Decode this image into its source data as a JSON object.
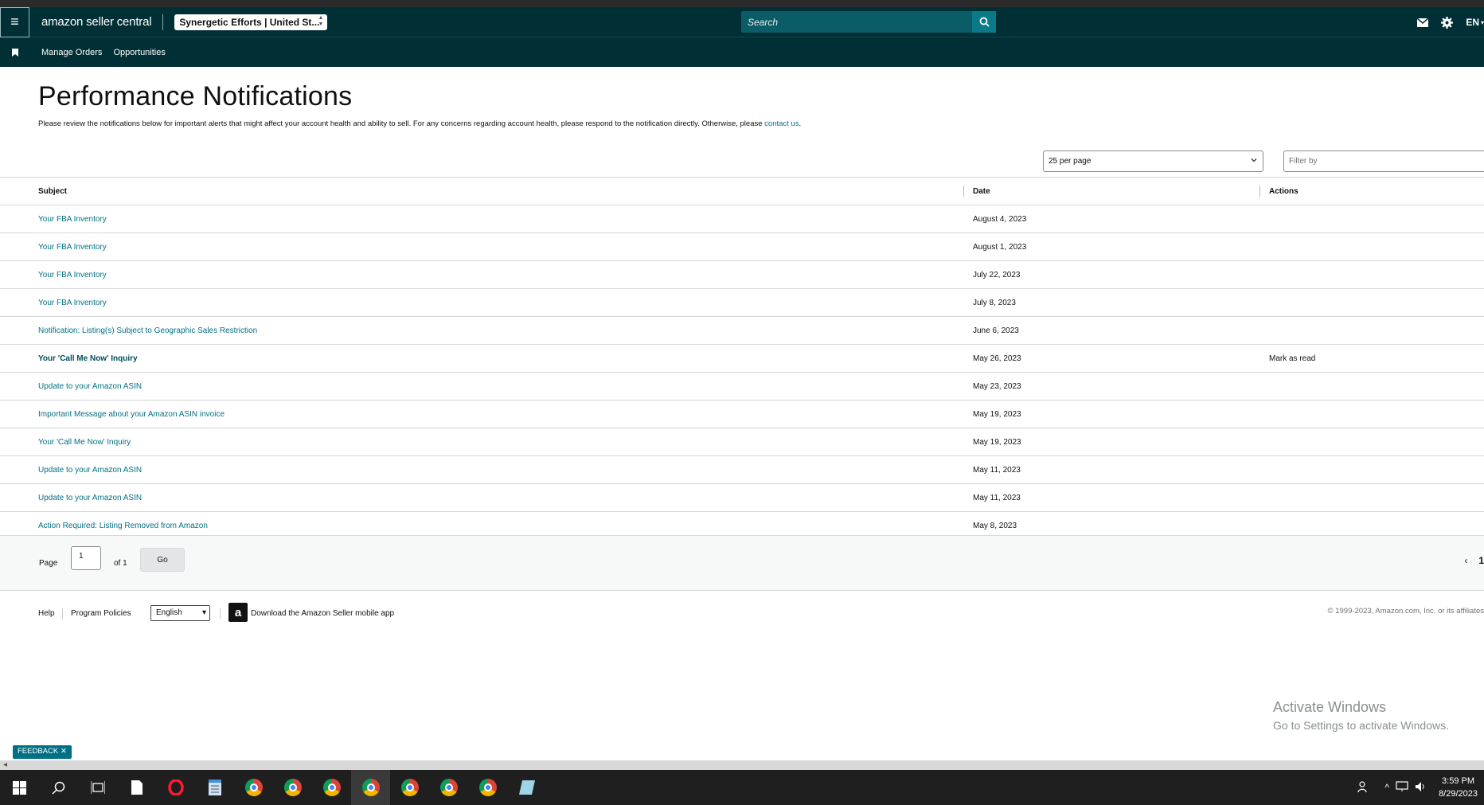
{
  "header": {
    "logo_text": "amazon seller central",
    "store_label": "Synergetic Efforts | United St...",
    "search_placeholder": "Search",
    "lang": "EN"
  },
  "nav": {
    "items": [
      "Manage Orders",
      "Opportunities"
    ]
  },
  "page": {
    "title": "Performance Notifications",
    "intro": "Please review the notifications below for important alerts that might affect your account health and ability to sell. For any concerns regarding account health, please respond to the notification directly. Otherwise, please ",
    "intro_link": "contact us",
    "intro_end": "."
  },
  "controls": {
    "per_page": "25 per page",
    "filter_placeholder": "Filter by"
  },
  "table": {
    "headers": [
      "Subject",
      "Date",
      "Actions"
    ],
    "rows": [
      {
        "subject": "Your FBA Inventory",
        "date": "August 4, 2023",
        "action": ""
      },
      {
        "subject": "Your FBA Inventory",
        "date": "August 1, 2023",
        "action": ""
      },
      {
        "subject": "Your FBA Inventory",
        "date": "July 22, 2023",
        "action": ""
      },
      {
        "subject": "Your FBA Inventory",
        "date": "July 8, 2023",
        "action": ""
      },
      {
        "subject": "Notification: Listing(s) Subject to Geographic Sales Restriction",
        "date": "June 6, 2023",
        "action": ""
      },
      {
        "subject": "Your 'Call Me Now' Inquiry",
        "date": "May 26, 2023",
        "action": "Mark as read",
        "unread": true
      },
      {
        "subject": "Update to your Amazon ASIN",
        "date": "May 23, 2023",
        "action": ""
      },
      {
        "subject": "Important Message about your Amazon ASIN invoice",
        "date": "May 19, 2023",
        "action": ""
      },
      {
        "subject": "Your 'Call Me Now' Inquiry",
        "date": "May 19, 2023",
        "action": ""
      },
      {
        "subject": "Update to your Amazon ASIN",
        "date": "May 11, 2023",
        "action": ""
      },
      {
        "subject": "Update to your Amazon ASIN",
        "date": "May 11, 2023",
        "action": ""
      },
      {
        "subject": "Action Required: Listing Removed from Amazon",
        "date": "May 8, 2023",
        "action": ""
      }
    ]
  },
  "pager": {
    "page_label": "Page",
    "page_value": "1",
    "of_label": "of 1",
    "go_label": "Go",
    "prev": "‹",
    "current": "1"
  },
  "footer": {
    "help": "Help",
    "policies": "Program Policies",
    "language": "English",
    "app_text": "Download the Amazon Seller mobile app",
    "copyright": "© 1999-2023, Amazon.com, Inc. or its affiliates"
  },
  "overlay": {
    "activate_title": "Activate Windows",
    "activate_sub": "Go to Settings to activate Windows.",
    "feedback": "FEEDBACK ✕"
  },
  "taskbar": {
    "time": "3:59 PM",
    "date": "8/29/2023"
  }
}
